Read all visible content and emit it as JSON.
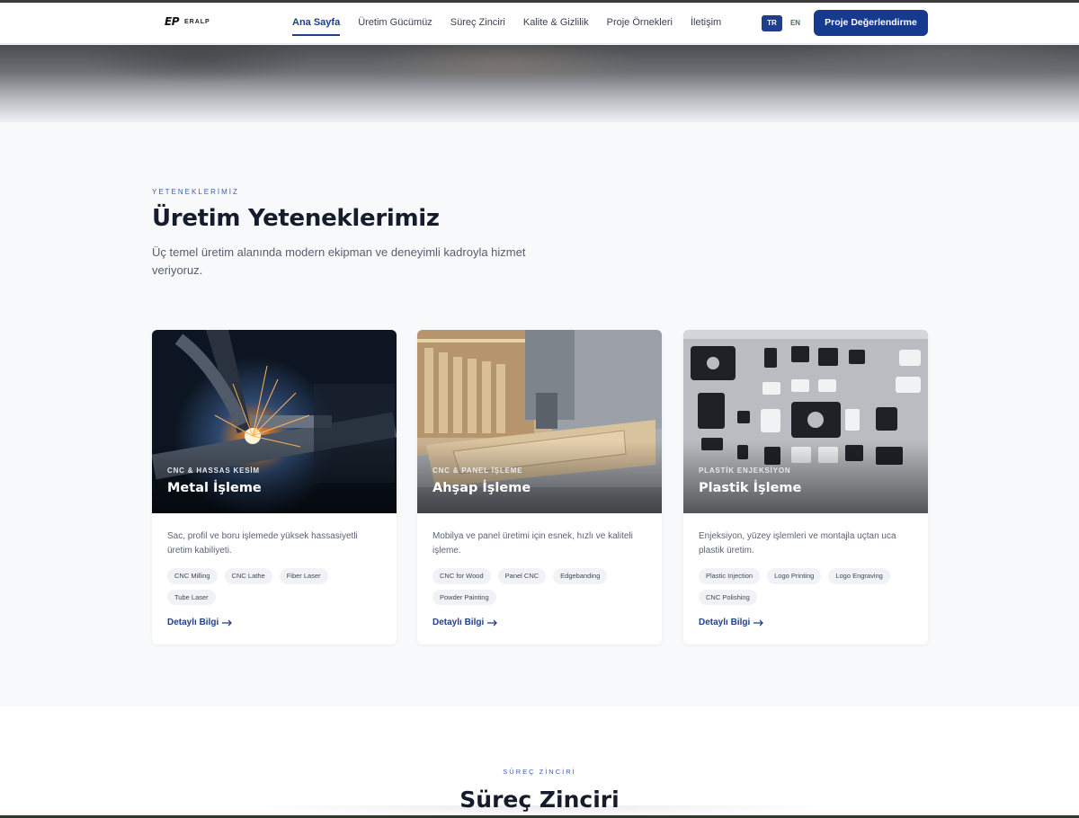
{
  "brand": {
    "mark": "EP",
    "name": "ERALP"
  },
  "nav": {
    "items": [
      {
        "label": "Ana Sayfa",
        "active": true
      },
      {
        "label": "Üretim Gücümüz"
      },
      {
        "label": "Süreç Zinciri"
      },
      {
        "label": "Kalite & Gizlilik"
      },
      {
        "label": "Proje Örnekleri"
      },
      {
        "label": "İletişim"
      }
    ]
  },
  "lang": {
    "tr": "TR",
    "en": "EN",
    "active": "TR"
  },
  "cta_label": "Proje Değerlendirme",
  "capabilities": {
    "eyebrow": "YETENEKLERİMİZ",
    "title": "Üretim Yeteneklerimiz",
    "lead": "Üç temel üretim alanında modern ekipman ve deneyimli kadroyla hizmet veriyoruz."
  },
  "cards": [
    {
      "category": "CNC & HASSAS KESİM",
      "title": "Metal İşleme",
      "description": "Sac, profil ve boru işlemede yüksek hassasiyetli üretim kabiliyeti.",
      "tags": [
        "CNC Milling",
        "CNC Lathe",
        "Fiber Laser",
        "Tube Laser"
      ],
      "link": "Detaylı Bilgi"
    },
    {
      "category": "CNC & PANEL İŞLEME",
      "title": "Ahşap İşleme",
      "description": "Mobilya ve panel üretimi için esnek, hızlı ve kaliteli işleme.",
      "tags": [
        "CNC for Wood",
        "Panel CNC",
        "Edgebanding",
        "Powder Painting"
      ],
      "link": "Detaylı Bilgi"
    },
    {
      "category": "PLASTİK ENJEKSİYON",
      "title": "Plastik İşleme",
      "description": "Enjeksiyon, yüzey işlemleri ve montajla uçtan uca plastik üretim.",
      "tags": [
        "Plastic Injection",
        "Logo Printing",
        "Logo Engraving",
        "CNC Polishing"
      ],
      "link": "Detaylı Bilgi"
    }
  ],
  "process": {
    "eyebrow": "SÜREÇ ZİNCİRİ",
    "title": "Süreç Zinciri"
  },
  "colors": {
    "primary": "#153a8e",
    "accent": "#3a62a8"
  },
  "icons": {
    "link_arrow": "arrow-right-icon"
  }
}
